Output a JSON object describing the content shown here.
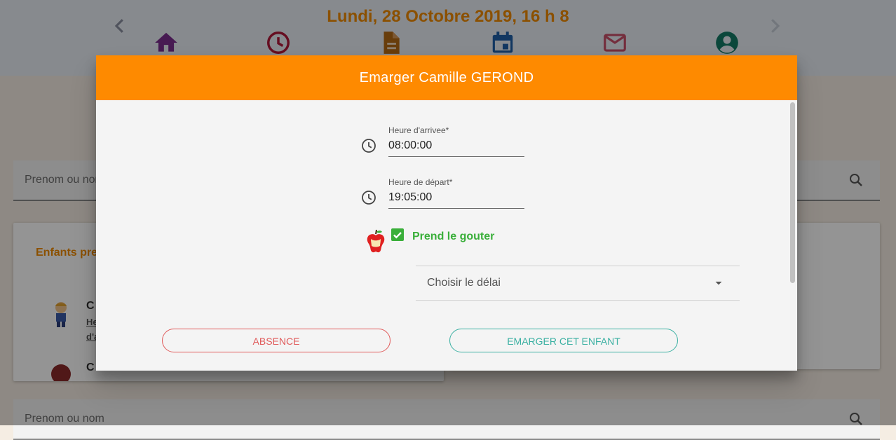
{
  "header": {
    "date_title": "Lundi, 28 Octobre 2019, 16 h 8",
    "nav_icons": [
      "home-icon",
      "clock-icon",
      "document-icon",
      "calendar-icon",
      "mail-icon",
      "account-icon"
    ]
  },
  "search_top": {
    "placeholder": "Prenom ou nom"
  },
  "search_bottom": {
    "placeholder": "Prenom ou nom"
  },
  "present_card": {
    "title": "Enfants pre",
    "children": [
      {
        "initial": "C",
        "line1": "He",
        "line2": "d'a"
      },
      {
        "initial": "C"
      }
    ]
  },
  "dialog": {
    "title": "Emarger Camille GEROND",
    "arrival": {
      "label": "Heure d'arrivee*",
      "value": "08:00:00"
    },
    "departure": {
      "label": "Heure de départ*",
      "value": "19:05:00"
    },
    "snack": {
      "label": "Prend le gouter",
      "checked": true
    },
    "delay_select": {
      "placeholder": "Choisir le délai"
    },
    "absence_button": "Absence",
    "emarger_button": "Emarger cet enfant"
  },
  "colors": {
    "accent_orange": "#fe8a00",
    "check_green": "#3aaf3a",
    "absence_red": "#e05a5a",
    "emarger_teal": "#3ab0a2"
  }
}
